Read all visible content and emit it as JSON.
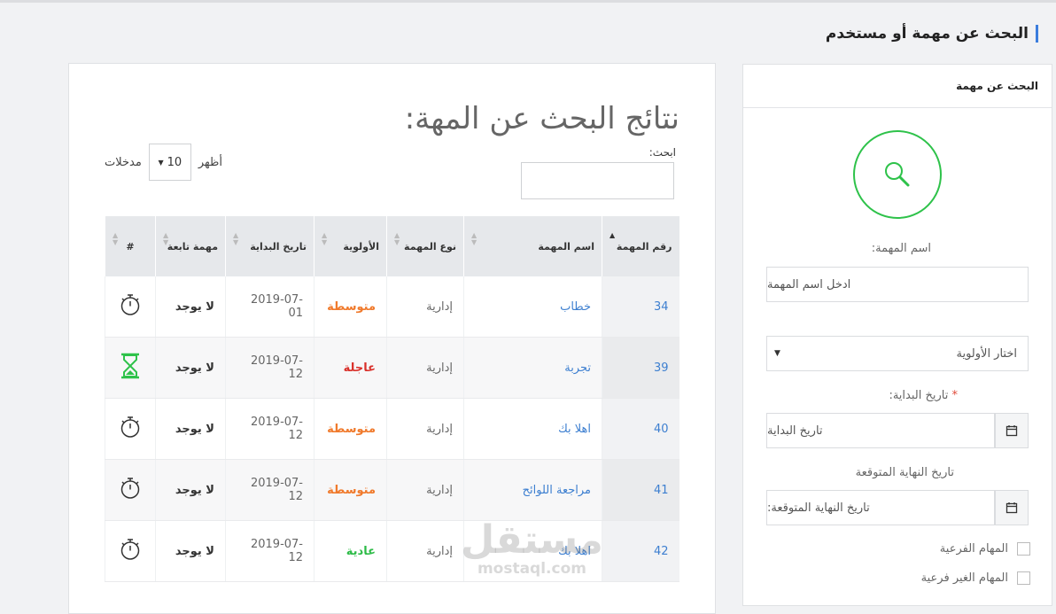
{
  "header": {
    "title": "البحث عن مهمة أو مستخدم"
  },
  "search_panel": {
    "heading": "البحث عن مهمة",
    "task_name_label": "اسم المهمة:",
    "task_name_placeholder": "ادخل اسم المهمة",
    "priority_select": "اختار الأولوية",
    "start_date_label": "تاريخ البداية:",
    "required_mark": "*",
    "start_date_placeholder": "تاريخ البداية",
    "end_date_label": "تاريخ النهاية المتوقعة",
    "end_date_placeholder": "تاريخ النهاية المتوقعة:",
    "subtasks_label": "المهام الفرعية",
    "non_subtasks_label": "المهام الغير فرعية"
  },
  "results": {
    "title": "نتائج البحث عن المهة:",
    "search_label": "ابحث:",
    "show_label": "أظهر",
    "entries_label": "مدخلات",
    "page_length": "10",
    "columns": {
      "id": "رقم المهمة",
      "name": "اسم المهمة",
      "type": "نوع المهمة",
      "priority": "الأولوية",
      "start": "تاريخ البداية",
      "subtask": "مهمة تابعة",
      "hash": "#"
    },
    "rows": [
      {
        "id": "34",
        "name": "خطاب",
        "type": "إدارية",
        "priority": "متوسطة",
        "priority_color": "#f07a2c",
        "start": "2019-07-01",
        "subtask": "لا يوجد",
        "icon": "stopwatch-icon"
      },
      {
        "id": "39",
        "name": "تجربة",
        "type": "إدارية",
        "priority": "عاجلة",
        "priority_color": "#d9312b",
        "start": "2019-07-12",
        "subtask": "لا يوجد",
        "icon": "hourglass-icon"
      },
      {
        "id": "40",
        "name": "اهلا بك",
        "type": "إدارية",
        "priority": "متوسطة",
        "priority_color": "#f07a2c",
        "start": "2019-07-12",
        "subtask": "لا يوجد",
        "icon": "stopwatch-icon"
      },
      {
        "id": "41",
        "name": "مراجعة اللوائح",
        "type": "إدارية",
        "priority": "متوسطة",
        "priority_color": "#f07a2c",
        "start": "2019-07-12",
        "subtask": "لا يوجد",
        "icon": "stopwatch-icon"
      },
      {
        "id": "42",
        "name": "اهلا بك",
        "type": "إدارية",
        "priority": "عادية",
        "priority_color": "#2dbb47",
        "start": "2019-07-12",
        "subtask": "لا يوجد",
        "icon": "stopwatch-icon"
      }
    ]
  },
  "watermark": {
    "arabic": "مستقل",
    "latin": "mostaql.com"
  },
  "colors": {
    "accent": "#3b7ddd",
    "success": "#2ec24a",
    "link": "#3d7fd0"
  }
}
